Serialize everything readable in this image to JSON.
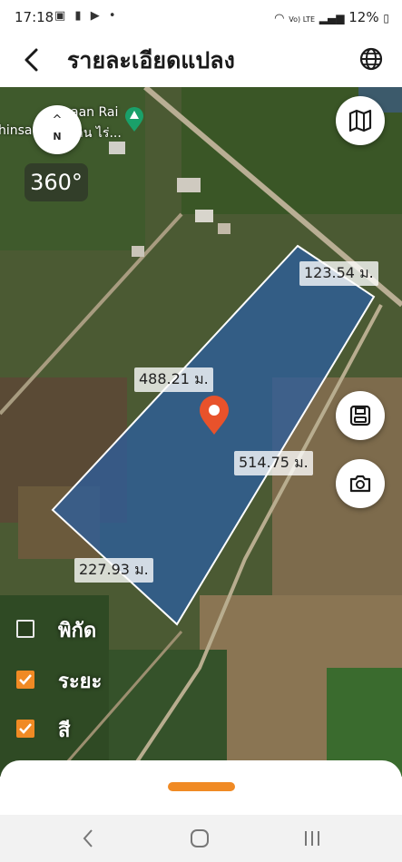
{
  "status": {
    "time": "17:18",
    "battery": "12%",
    "net": "Vo) LTE"
  },
  "header": {
    "title": "รายละเอียดแปลง"
  },
  "map": {
    "compass_label": "N",
    "panorama_label": "360°",
    "place_label": "aan Rai",
    "place_label_2": "hinsa",
    "place_label_3": "าน ไร่...",
    "distances": {
      "top_right": "123.54 ม.",
      "left_side": "488.21 ม.",
      "right_side": "514.75 ม.",
      "bottom": "227.93 ม."
    }
  },
  "options": [
    {
      "label": "พิกัด",
      "checked": false
    },
    {
      "label": "ระยะ",
      "checked": true
    },
    {
      "label": "สี",
      "checked": true
    }
  ],
  "colors": {
    "accent": "#f08a24",
    "plot_fill": "#2d5d9c",
    "pin": "#e8522b"
  }
}
